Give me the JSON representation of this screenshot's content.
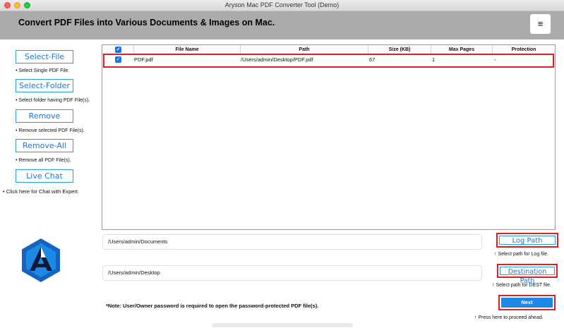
{
  "window": {
    "title": "Aryson Mac PDF Converter Tool (Demo)"
  },
  "header": {
    "title": "Convert PDF Files into Various Documents & Images on Mac.",
    "menu_icon": "≡"
  },
  "sidebar": {
    "select_file_label": "Select-File",
    "select_file_hint": "• Select Single PDF File.",
    "select_folder_label": "Select-Folder",
    "select_folder_hint": "• Select folder having PDF File(s).",
    "remove_label": "Remove",
    "remove_hint": "• Remove selected PDF File(s).",
    "remove_all_label": "Remove-All",
    "remove_all_hint": "• Remove all PDF File(s).",
    "live_chat_label": "Live Chat",
    "live_chat_hint": "• Click here for Chat with Expert."
  },
  "table": {
    "columns": [
      "File Name",
      "Path",
      "Size (KB)",
      "Max Pages",
      "Protection"
    ],
    "rows": [
      {
        "checked": true,
        "file_name": "PDF.pdf",
        "path": "/Users/admin/Desktop/PDF.pdf",
        "size": "67",
        "max_pages": "1",
        "protection": "-"
      }
    ]
  },
  "log": {
    "path_value": "/Users/admin/Documents",
    "button_label": "Log Path",
    "hint": "↑ Select path for Log file."
  },
  "destination": {
    "path_value": "/Users/admin/Desktop",
    "button_label": "Destination Path",
    "hint": "↑ Select path for DEST file."
  },
  "note": "*Note: User/Owner password is required to open the password-protected PDF file(s).",
  "next": {
    "label": "Next",
    "hint": "↑ Press here to proceed ahead."
  },
  "colors": {
    "accent": "#1e88e5",
    "highlight": "#d91f26",
    "header_bg": "#ababab",
    "logo_blue": "#1565c0"
  }
}
